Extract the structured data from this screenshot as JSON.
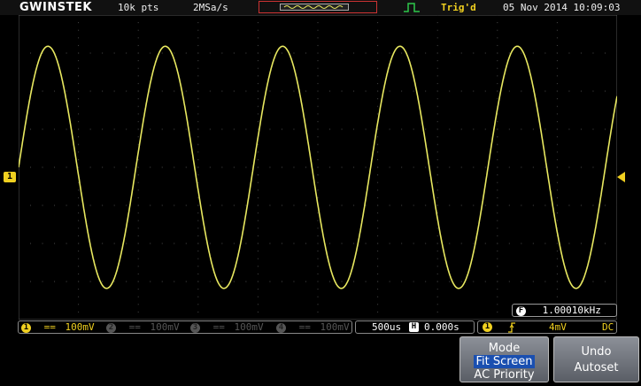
{
  "topbar": {
    "brand": "GWINSTEK",
    "record_length": "10k pts",
    "sample_rate": "2MSa/s",
    "trigger_status": "Trig'd",
    "datetime": "05 Nov 2014 10:09:03"
  },
  "colors": {
    "trace": "#e8e860",
    "channel1": "#f0d020",
    "grid": "#4a4a4a"
  },
  "markers": {
    "ch1_label": "1"
  },
  "waveform": {
    "cycles_on_screen": 5.1,
    "amplitude_div": 3.18,
    "offset_div": 0
  },
  "frequency": {
    "icon_label": "F",
    "value": "1.00010kHz"
  },
  "channels": [
    {
      "num": "1",
      "coupling": "==",
      "scale": "100mV"
    },
    {
      "num": "2",
      "coupling": "==",
      "scale": "100mV"
    },
    {
      "num": "3",
      "coupling": "==",
      "scale": "100mV"
    },
    {
      "num": "4",
      "coupling": "==",
      "scale": "100mV"
    }
  ],
  "timebase": {
    "scale": "500us",
    "icon_label": "H",
    "position": "0.000s"
  },
  "trigger": {
    "source": "1",
    "level": "4mV",
    "coupling": "DC"
  },
  "softkeys": {
    "mode_title": "Mode",
    "mode_option1": "Fit Screen",
    "mode_option2": "AC Priority",
    "undo_line1": "Undo",
    "undo_line2": "Autoset"
  }
}
